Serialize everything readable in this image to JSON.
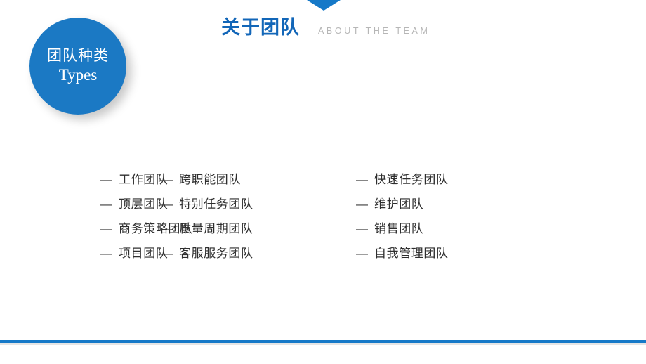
{
  "slide": {
    "background_color": "#ffffff",
    "accent_color": "#1679c8",
    "title_color": "#1266b8",
    "subtitle_color": "#b6b6b6",
    "circle_color": "#1b79c4",
    "text_color": "#2e2e2e"
  },
  "header": {
    "title_cn": "关于团队",
    "title_en": "ABOUT THE TEAM"
  },
  "badge": {
    "line1": "团队种类",
    "line2": "Types"
  },
  "list": {
    "dash": "—",
    "columns": [
      {
        "items": [
          "工作团队",
          "顶层团队",
          "商务策略团队",
          "项目团队"
        ]
      },
      {
        "items": [
          "跨职能团队",
          "特别任务团队",
          "质量周期团队",
          "客服服务团队"
        ]
      },
      {
        "items": [
          "快速任务团队",
          "维护团队",
          "销售团队",
          "自我管理团队"
        ]
      }
    ]
  }
}
